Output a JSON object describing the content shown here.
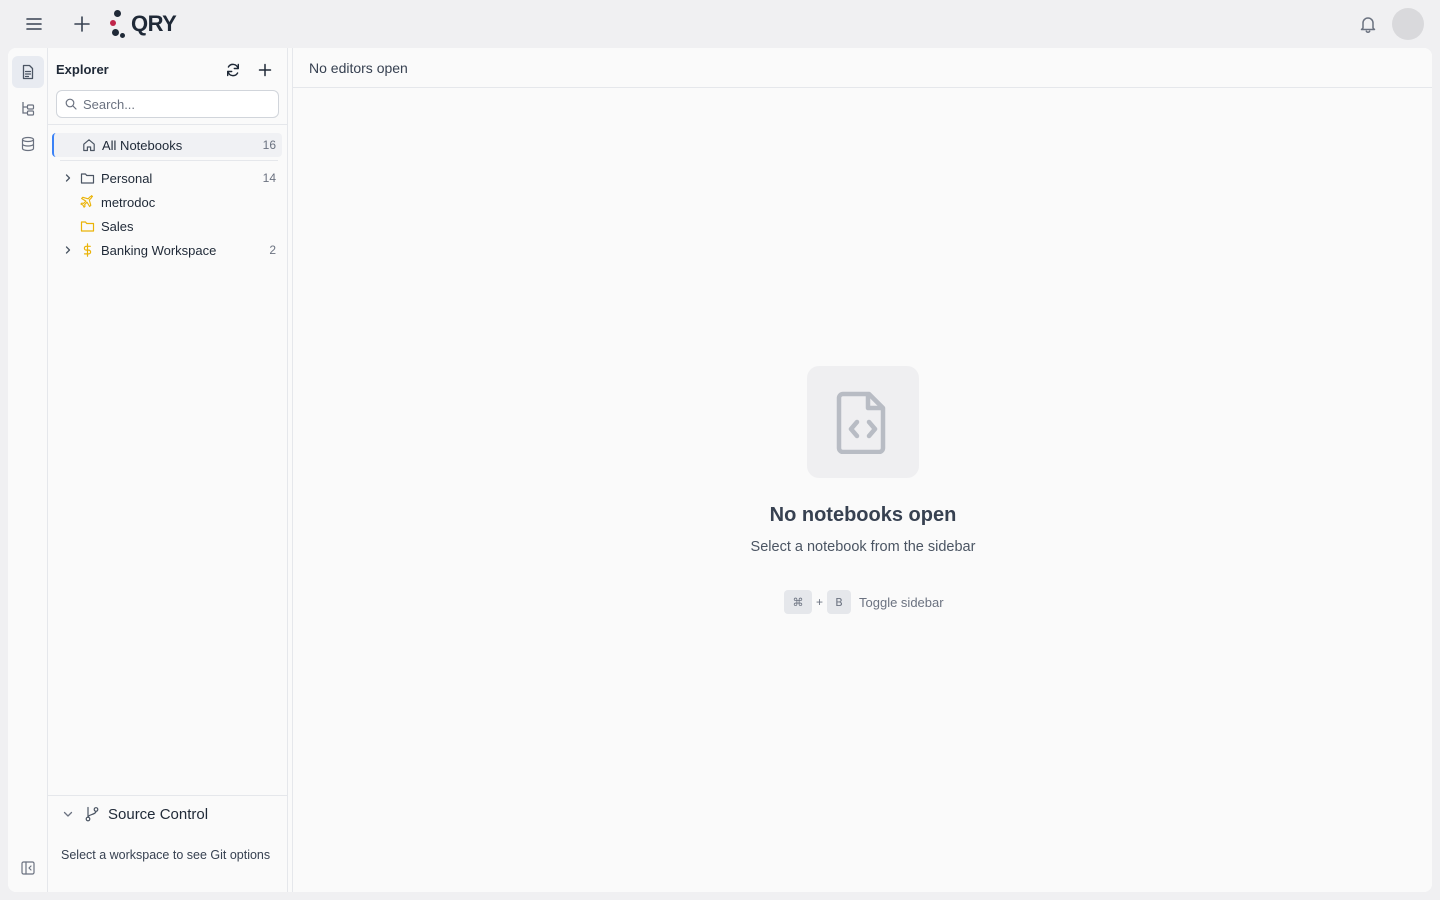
{
  "app": {
    "logo_text": "QRY"
  },
  "explorer": {
    "title": "Explorer",
    "search_placeholder": "Search...",
    "all_notebooks": {
      "label": "All Notebooks",
      "count": "16"
    },
    "items": [
      {
        "label": "Personal",
        "count": "14",
        "icon": "folder-icon",
        "expandable": true
      },
      {
        "label": "metrodoc",
        "count": "",
        "icon": "plane-icon",
        "expandable": false
      },
      {
        "label": "Sales",
        "count": "",
        "icon": "folder-icon",
        "expandable": false
      },
      {
        "label": "Banking Workspace",
        "count": "2",
        "icon": "dollar-icon",
        "expandable": true
      }
    ]
  },
  "source_control": {
    "title": "Source Control",
    "message": "Select a workspace to see Git options"
  },
  "editor": {
    "tabs_empty_label": "No editors open",
    "empty_title": "No notebooks open",
    "empty_subtitle": "Select a notebook from the sidebar",
    "shortcut": {
      "key1": "⌘",
      "plus": "+",
      "key2": "B",
      "label": "Toggle sidebar"
    }
  },
  "colors": {
    "accent": "#3b82f6",
    "folder": "#eab308",
    "icon_gray": "#6b7280"
  }
}
